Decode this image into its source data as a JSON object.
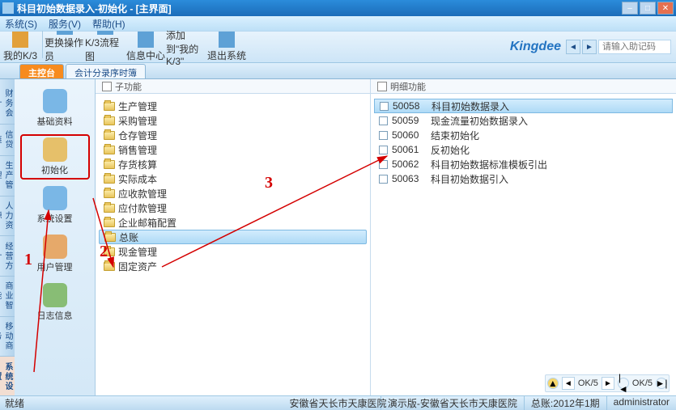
{
  "title": "科目初始数据录入-初始化 - [主界面]",
  "menubar": [
    "系统(S)",
    "服务(V)",
    "帮助(H)"
  ],
  "help_placeholder": "请输入助记码",
  "toolbar": [
    {
      "label": "我的K/3",
      "icon": "#e2a03a"
    },
    {
      "label": "更换操作员",
      "icon": "#5ea1d6"
    },
    {
      "label": "K/3流程图",
      "icon": "#5ea1d6"
    },
    {
      "label": "信息中心",
      "icon": "#5ea1d6"
    },
    {
      "label": "添加到\"我的K/3\"",
      "icon": "#5ea1d6"
    },
    {
      "label": "退出系统",
      "icon": "#5ea1d6"
    }
  ],
  "logo": "Kingdee",
  "tabs": [
    {
      "label": "主控台",
      "active": true
    },
    {
      "label": "会计分录序时簿",
      "active": false
    }
  ],
  "sidetabs": [
    "财务会计",
    "信贷链",
    "生产管理",
    "人力资源",
    "经营方针",
    "商业智能",
    "移动商务",
    "系统设置"
  ],
  "sidetab_active_index": 7,
  "nav_items": [
    {
      "label": "基础资料",
      "icon": "#7ab7e6",
      "selected": false
    },
    {
      "label": "初始化",
      "icon": "#e6c06a",
      "selected": true
    },
    {
      "label": "系统设置",
      "icon": "#7ab7e6",
      "selected": false
    },
    {
      "label": "用户管理",
      "icon": "#e6a96a",
      "selected": false
    },
    {
      "label": "日志信息",
      "icon": "#88bd75",
      "selected": false
    }
  ],
  "sub_header": "子功能",
  "detail_header": "明细功能",
  "sub_items": [
    {
      "label": "生产管理"
    },
    {
      "label": "采购管理"
    },
    {
      "label": "仓存管理"
    },
    {
      "label": "销售管理"
    },
    {
      "label": "存货核算"
    },
    {
      "label": "实际成本"
    },
    {
      "label": "应收款管理"
    },
    {
      "label": "应付款管理"
    },
    {
      "label": "企业邮箱配置"
    },
    {
      "label": "总账",
      "selected": true,
      "redbox": true
    },
    {
      "label": "现金管理"
    },
    {
      "label": "固定资产"
    }
  ],
  "detail_items": [
    {
      "code": "50058",
      "label": "科目初始数据录入",
      "selected": true,
      "redbox": true
    },
    {
      "code": "50059",
      "label": "现金流量初始数据录入"
    },
    {
      "code": "50060",
      "label": "结束初始化"
    },
    {
      "code": "50061",
      "label": "反初始化"
    },
    {
      "code": "50062",
      "label": "科目初始数据标准模板引出"
    },
    {
      "code": "50063",
      "label": "科目初始数据引入"
    }
  ],
  "annotations": {
    "1": "1",
    "2": "2",
    "3": "3"
  },
  "pager": {
    "left": "OK/5",
    "right": "OK/5"
  },
  "status": {
    "left": "就绪",
    "center": "安徽省天长市天康医院",
    "r1": "演示版-安徽省天长市天康医院",
    "r2": "总账:2012年1期",
    "r3": "administrator"
  }
}
